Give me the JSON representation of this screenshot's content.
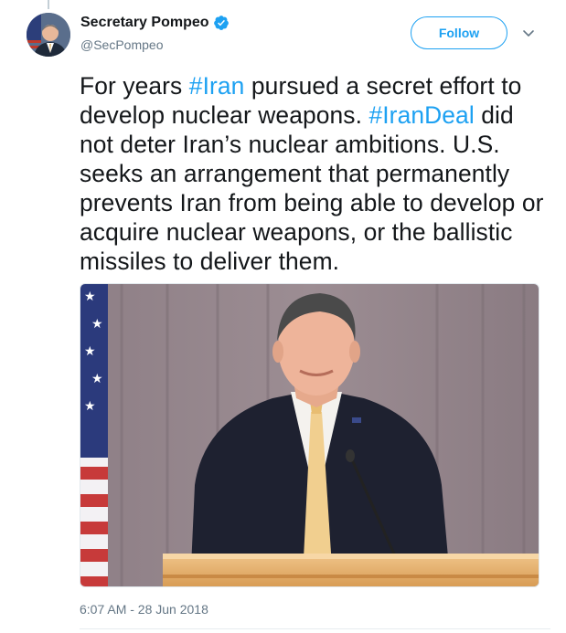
{
  "user": {
    "display_name": "Secretary Pompeo",
    "handle": "@SecPompeo",
    "verified": true,
    "avatar_alt": "profile photo"
  },
  "actions": {
    "follow_label": "Follow",
    "caret_icon": "chevron-down-icon"
  },
  "tweet": {
    "segments": [
      {
        "text": "For years ",
        "hashtag": false
      },
      {
        "text": "#Iran",
        "hashtag": true
      },
      {
        "text": " pursued a secret effort to develop nuclear weapons. ",
        "hashtag": false
      },
      {
        "text": "#IranDeal",
        "hashtag": true
      },
      {
        "text": " did not deter Iran’s nuclear ambitions. U.S. seeks an arrangement that permanently prevents Iran from being able to develop or acquire nuclear weapons, or the ballistic missiles to deliver them.",
        "hashtag": false
      }
    ],
    "timestamp": "6:07 AM - 28 Jun 2018"
  },
  "colors": {
    "accent": "#1da1f2",
    "text": "#14171a",
    "muted": "#657786"
  }
}
